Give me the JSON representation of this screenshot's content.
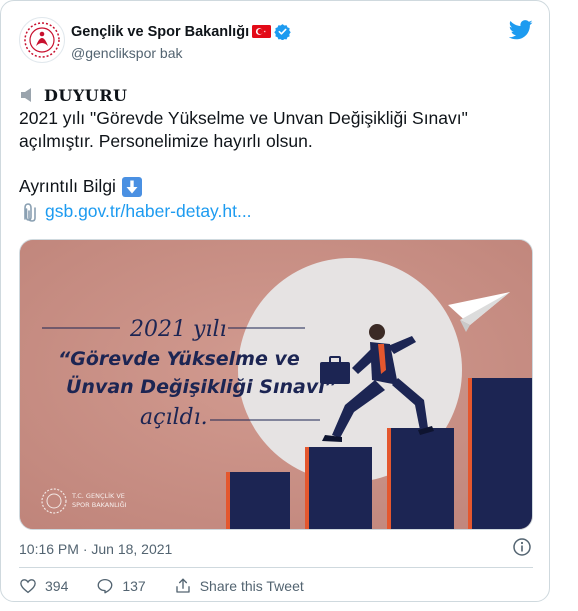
{
  "account": {
    "name": "Gençlik ve Spor Bakanlığı",
    "handle": "@genclikspor bak"
  },
  "tweet": {
    "announcement": "DUYURU",
    "body_line1": "2021 yılı \"Görevde Yükselme ve Unvan Değişikliği Sınavı\"",
    "body_line2": "açılmıştır. Personelimize hayırlı olsun.",
    "detail_label": "Ayrıntılı Bilgi",
    "link_text": "gsb.gov.tr/haber-detay.ht..."
  },
  "media": {
    "year_text": "2021 yılı",
    "quote_line1": "“Görevde Yükselme ve",
    "quote_line2": "Ünvan Değişikliği Sınavı”",
    "status_text": "açıldı.",
    "logo_line1": "T.C. GENÇLİK VE",
    "logo_line2": "SPOR BAKANLIĞI"
  },
  "meta": {
    "timestamp": "10:16 PM · Jun 18, 2021"
  },
  "actions": {
    "likes": "394",
    "replies": "137",
    "share_label": "Share this Tweet"
  },
  "colors": {
    "link": "#1d9bf0",
    "verified": "#1d9bf0",
    "media_bg": "#c99086",
    "bars": "#1c2553",
    "bar_accent": "#e4572e"
  }
}
